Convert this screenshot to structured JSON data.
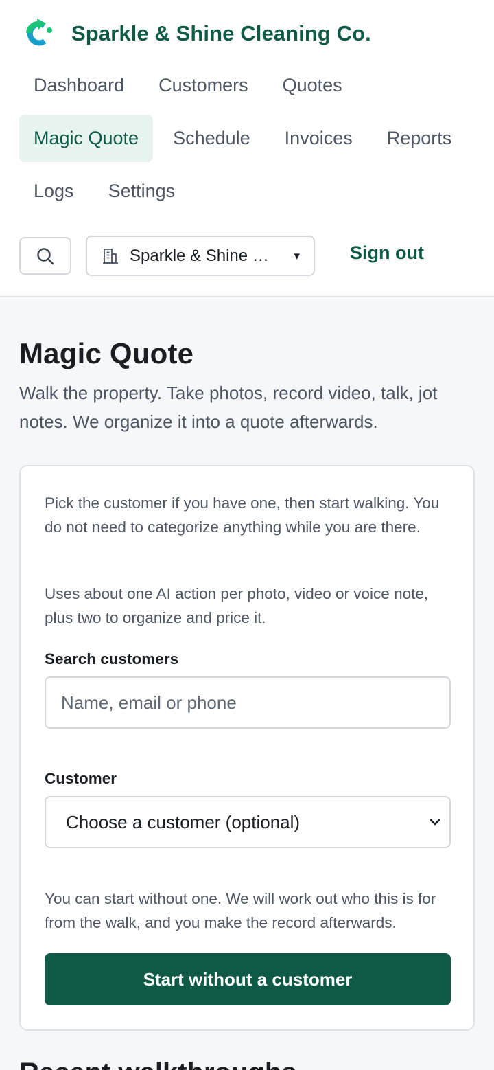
{
  "app": {
    "name": "Sparkle & Shine Cleaning Co.",
    "brand_color": "#0f5a46",
    "logo_colors": [
      "#1cc47a",
      "#149ec9"
    ]
  },
  "nav": {
    "rows": [
      [
        {
          "label": "Dashboard"
        },
        {
          "label": "Customers"
        },
        {
          "label": "Quotes"
        }
      ],
      [
        {
          "label": "Magic Quote",
          "active": true
        },
        {
          "label": "Schedule"
        },
        {
          "label": "Invoices"
        },
        {
          "label": "Reports"
        }
      ],
      [
        {
          "label": "Logs"
        },
        {
          "label": "Settings"
        }
      ]
    ]
  },
  "toolbar": {
    "search_icon": "search-icon",
    "org_icon": "building-icon",
    "org_name": "Sparkle & Shine …",
    "org_caret": "▾",
    "signout_label": "Sign out"
  },
  "page": {
    "title": "Magic Quote",
    "subtitle": "Walk the property. Take photos, record video, talk, jot notes. We organize it into a quote afterwards."
  },
  "card": {
    "intro": "Pick the customer if you have one, then start walking. You do not need to categorize anything while you are there.",
    "usage": "Uses about one AI action per photo, video or voice note, plus two to organize and price it.",
    "search_label": "Search customers",
    "search_placeholder": "Name, email or phone",
    "customer_label": "Customer",
    "customer_selected": "Choose a customer (optional)",
    "hint": "You can start without one. We will work out who this is for from the walk, and you make the record afterwards.",
    "start_button": "Start without a customer"
  },
  "next_section": {
    "heading": "Recent walkthroughs"
  }
}
